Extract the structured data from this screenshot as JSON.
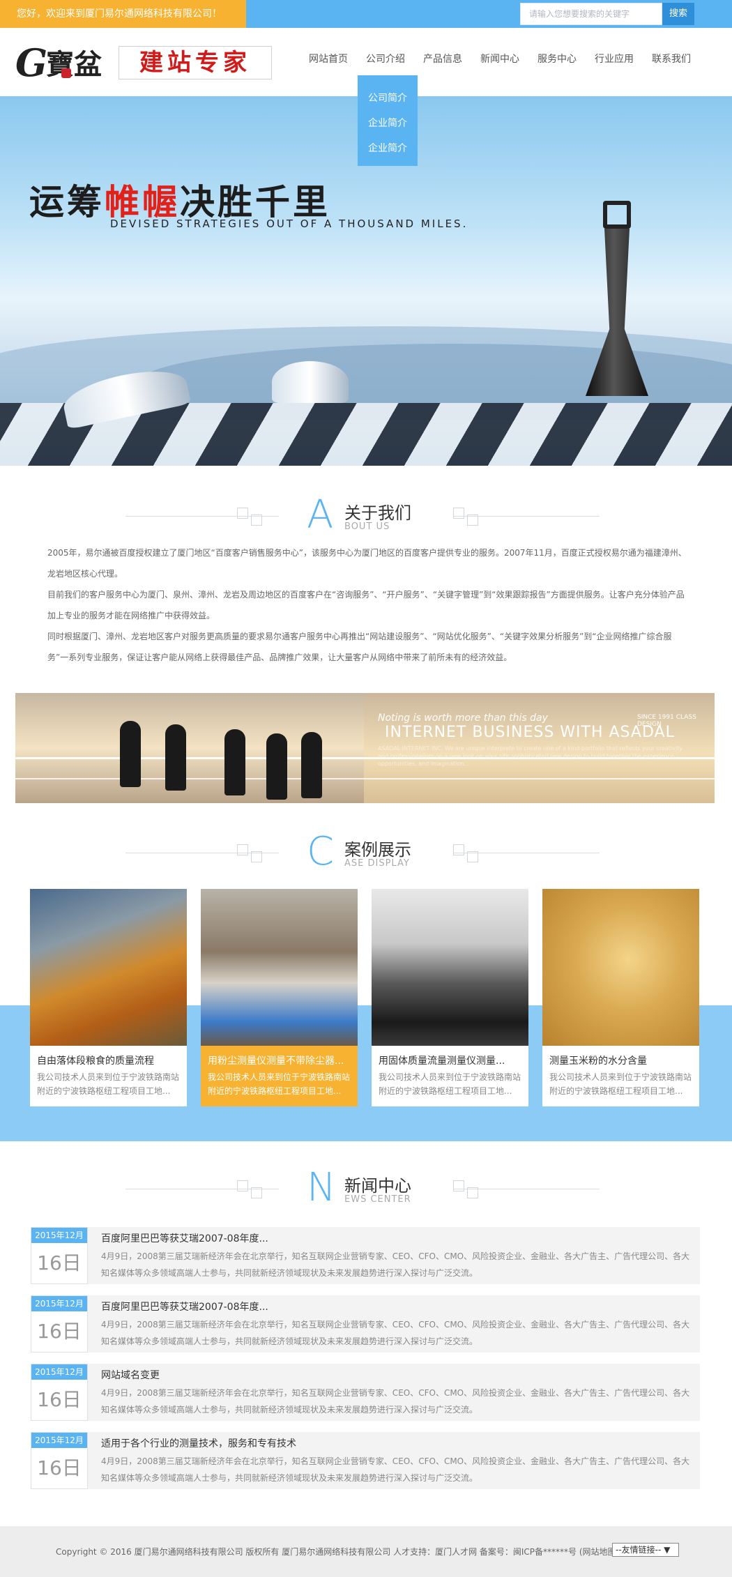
{
  "topbar": {
    "welcome": "您好，欢迎来到厦门易尔通网络科技有限公司！",
    "search_placeholder": "请输入您想要搜索的关键字",
    "search_button": "搜索"
  },
  "logo": {
    "g": "G",
    "bao": "寶盆",
    "cn": "建站专家"
  },
  "nav": {
    "items": [
      "网站首页",
      "公司介绍",
      "产品信息",
      "新闻中心",
      "服务中心",
      "行业应用",
      "联系我们"
    ],
    "dropdown": [
      "公司简介",
      "企业简介",
      "企业简介"
    ]
  },
  "banner": {
    "slogan_a": "运筹",
    "slogan_red": "帷幄",
    "slogan_b": "决胜千里",
    "sub": "DEVISED STRATEGIES OUT OF A THOUSAND MILES."
  },
  "about": {
    "letter": "A",
    "title": "关于我们",
    "subtitle": "BOUT US",
    "paragraphs": [
      "2005年，易尔通被百度授权建立了厦门地区“百度客户销售服务中心”，该服务中心为厦门地区的百度客户提供专业的服务。2007年11月，百度正式授权易尔通为福建漳州、龙岩地区核心代理。",
      "目前我们的客户服务中心为厦门、泉州、漳州、龙岩及周边地区的百度客户在“咨询服务”、“开户服务”、“关键字管理”到“效果跟踪报告”方面提供服务。让客户充分体验产品加上专业的服务才能在网络推广中获得效益。",
      "同时根据厦门、漳州、龙岩地区客户对服务更高质量的要求易尔通客户服务中心再推出“网站建设服务”、“网站优化服务”、“关键字效果分析服务”到“企业网络推广综合服务”一系列专业服务，保证让客户能从网络上获得最佳产品、品牌推广效果，让大量客户从网络中带来了前所未有的经济效益。"
    ],
    "strip_line1": "Noting is worth more than this day",
    "strip_line2": "INTERNET BUSINESS WITH ASADAL",
    "strip_tag": "SINCE 1991 CLASS DESIGN",
    "strip_line3": "ASADAL INTERNET INC. We are unique interprete to create one of a kind portfolio that reflects your creativity and professionalism on a new look on your site sophisticated new design to build together the experience, opportunities, and imagination..."
  },
  "cases": {
    "letter": "C",
    "title": "案例展示",
    "subtitle": "ASE DISPLAY",
    "items": [
      {
        "title": "自由落体段粮食的质量流程",
        "desc": "我公司技术人员来到位于宁波铁路南站附近的宁波铁路枢纽工程项目工地..."
      },
      {
        "title": "用粉尘测量仪测量不带除尘器...",
        "desc": "我公司技术人员来到位于宁波铁路南站附近的宁波铁路枢纽工程项目工地..."
      },
      {
        "title": "用固体质量流量测量仪测量...",
        "desc": "我公司技术人员来到位于宁波铁路南站附近的宁波铁路枢纽工程项目工地..."
      },
      {
        "title": "测量玉米粉的水分含量",
        "desc": "我公司技术人员来到位于宁波铁路南站附近的宁波铁路枢纽工程项目工地..."
      }
    ]
  },
  "news": {
    "letter": "N",
    "title": "新闻中心",
    "subtitle": "EWS CENTER",
    "items": [
      {
        "ym": "2015年12月",
        "day": "16日",
        "title": "百度阿里巴巴等获艾瑞2007-08年度...",
        "summary": "4月9日，2008第三届艾瑞新经济年会在北京举行，知名互联网企业营销专家、CEO、CFO、CMO、风险投资企业、金融业、各大广告主、广告代理公司、各大知名媒体等众多领域高端人士参与，共同就新经济领域现状及未来发展趋势进行深入探讨与广泛交流。"
      },
      {
        "ym": "2015年12月",
        "day": "16日",
        "title": "百度阿里巴巴等获艾瑞2007-08年度...",
        "summary": "4月9日，2008第三届艾瑞新经济年会在北京举行，知名互联网企业营销专家、CEO、CFO、CMO、风险投资企业、金融业、各大广告主、广告代理公司、各大知名媒体等众多领域高端人士参与，共同就新经济领域现状及未来发展趋势进行深入探讨与广泛交流。"
      },
      {
        "ym": "2015年12月",
        "day": "16日",
        "title": "网站域名变更",
        "summary": "4月9日，2008第三届艾瑞新经济年会在北京举行，知名互联网企业营销专家、CEO、CFO、CMO、风险投资企业、金融业、各大广告主、广告代理公司、各大知名媒体等众多领域高端人士参与，共同就新经济领域现状及未来发展趋势进行深入探讨与广泛交流。"
      },
      {
        "ym": "2015年12月",
        "day": "16日",
        "title": "适用于各个行业的测量技术，服务和专有技术",
        "summary": "4月9日，2008第三届艾瑞新经济年会在北京举行，知名互联网企业营销专家、CEO、CFO、CMO、风险投资企业、金融业、各大广告主、广告代理公司、各大知名媒体等众多领域高端人士参与，共同就新经济领域现状及未来发展趋势进行深入探讨与广泛交流。"
      }
    ]
  },
  "footer": {
    "copyright": "Copyright © 2016 厦门易尔通网络科技有限公司 版权所有 厦门易尔通网络科技有限公司 人才支持：厦门人才网 备案号：闽ICP备******号 (网站地图)",
    "select": "--友情链接-- ▼"
  }
}
